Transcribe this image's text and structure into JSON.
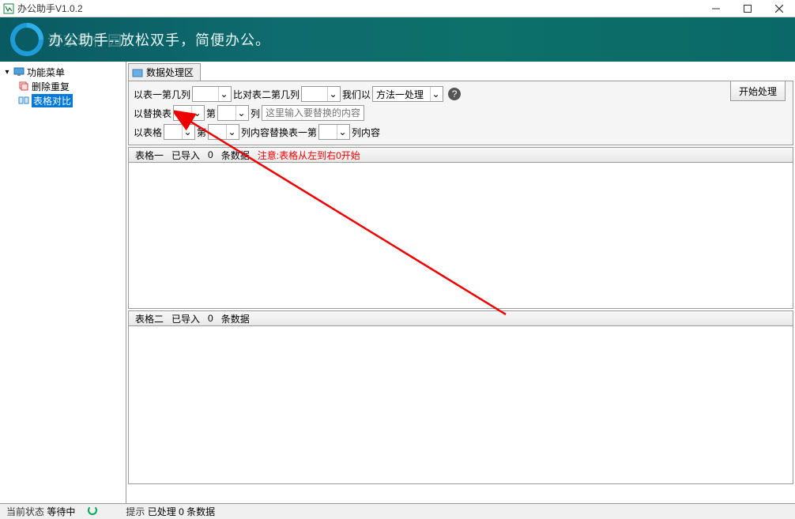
{
  "titlebar": {
    "title": "办公助手V1.0.2"
  },
  "banner": {
    "text": "办公助手--放松双手，简便办公。",
    "watermark": "河东软件园"
  },
  "sidebar": {
    "root": "功能菜单",
    "items": [
      {
        "label": "删除重复"
      },
      {
        "label": "表格对比",
        "selected": true
      }
    ]
  },
  "tab": {
    "label": "数据处理区"
  },
  "toolbar": {
    "row1": {
      "prefix1": "以表一第几列",
      "prefix2": "比对表二第几列",
      "prefix3": "我们以",
      "method_value": "方法一处理"
    },
    "row2": {
      "prefix1": "以替换表",
      "prefix2": "第",
      "prefix3": "列",
      "placeholder": "这里输入要替换的内容"
    },
    "row3": {
      "prefix1": "以表格",
      "prefix2": "第",
      "prefix3": "列内容替换表一第",
      "prefix4": "列内容"
    }
  },
  "process_btn": "开始处理",
  "table1": {
    "name": "表格一",
    "imported": "已导入",
    "count": "0",
    "records": "条数据",
    "note": "注意:表格从左到右0开始"
  },
  "table2": {
    "name": "表格二",
    "imported": "已导入",
    "count": "0",
    "records": "条数据"
  },
  "statusbar": {
    "state_label": "当前状态",
    "state_value": "等待中",
    "hint_label": "提示",
    "hint_value": "已处理 0 条数据"
  }
}
